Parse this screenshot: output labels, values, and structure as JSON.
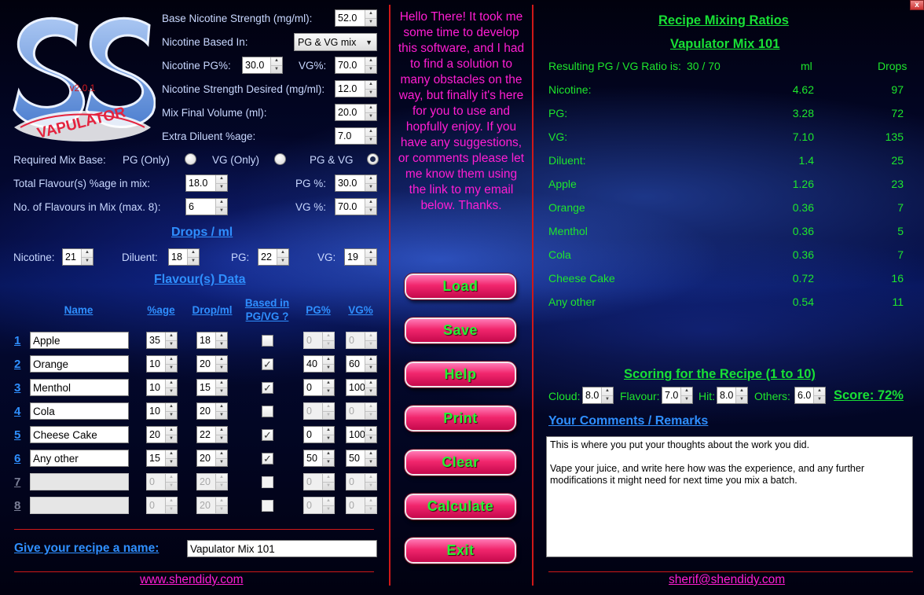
{
  "app": {
    "close_label": "x",
    "logo": {
      "version": "v2.0.1",
      "name": "VAPULATOR",
      "letters": "SS"
    }
  },
  "settings": {
    "base_nicotine_label": "Base Nicotine Strength (mg/ml):",
    "base_nicotine_value": "52.0",
    "nicotine_based_in_label": "Nicotine Based In:",
    "nicotine_based_in_value": "PG & VG mix",
    "nicotine_pg_label": "Nicotine PG%:",
    "nicotine_pg_value": "30.0",
    "nicotine_vg_label": "VG%:",
    "nicotine_vg_value": "70.0",
    "nicotine_desired_label": "Nicotine Strength Desired (mg/ml):",
    "nicotine_desired_value": "12.0",
    "final_volume_label": "Mix Final Volume (ml):",
    "final_volume_value": "20.0",
    "extra_diluent_label": "Extra Diluent %age:",
    "extra_diluent_value": "7.0",
    "mix_base_label": "Required Mix Base:",
    "mix_base_pg_label": "PG (Only)",
    "mix_base_vg_label": "VG (Only)",
    "mix_base_pgvg_label": "PG & VG",
    "total_flavour_label": "Total Flavour(s) %age in mix:",
    "total_flavour_value": "18.0",
    "pg_pct_label": "PG %:",
    "pg_pct_value": "30.0",
    "no_flavours_label": "No. of Flavours in Mix (max. 8):",
    "no_flavours_value": "6",
    "vg_pct_label": "VG %:",
    "vg_pct_value": "70.0"
  },
  "drops": {
    "title": "Drops / ml",
    "nicotine_label": "Nicotine:",
    "nicotine_value": "21",
    "diluent_label": "Diluent:",
    "diluent_value": "18",
    "pg_label": "PG:",
    "pg_value": "22",
    "vg_label": "VG:",
    "vg_value": "19"
  },
  "flavours": {
    "title": "Flavour(s) Data",
    "columns": {
      "name": "Name",
      "pct": "%age",
      "drop": "Drop/ml",
      "based": "Based in PG/VG ?",
      "pg": "PG%",
      "vg": "VG%"
    },
    "rows": [
      {
        "num": "1",
        "name": "Apple",
        "pct": "35",
        "drop": "18",
        "based": false,
        "pg": "0",
        "vg": "0"
      },
      {
        "num": "2",
        "name": "Orange",
        "pct": "10",
        "drop": "20",
        "based": true,
        "pg": "40",
        "vg": "60"
      },
      {
        "num": "3",
        "name": "Menthol",
        "pct": "10",
        "drop": "15",
        "based": true,
        "pg": "0",
        "vg": "100"
      },
      {
        "num": "4",
        "name": "Cola",
        "pct": "10",
        "drop": "20",
        "based": false,
        "pg": "0",
        "vg": "0"
      },
      {
        "num": "5",
        "name": "Cheese Cake",
        "pct": "20",
        "drop": "22",
        "based": true,
        "pg": "0",
        "vg": "100"
      },
      {
        "num": "6",
        "name": "Any other",
        "pct": "15",
        "drop": "20",
        "based": true,
        "pg": "50",
        "vg": "50"
      },
      {
        "num": "7",
        "name": "",
        "pct": "0",
        "drop": "20",
        "based": false,
        "pg": "0",
        "vg": "0"
      },
      {
        "num": "8",
        "name": "",
        "pct": "0",
        "drop": "20",
        "based": false,
        "pg": "0",
        "vg": "0"
      }
    ]
  },
  "recipe_name": {
    "label": "Give your recipe a name:",
    "value": "Vapulator Mix 101"
  },
  "links": {
    "website": "www.shendidy.com",
    "email": "sherif@shendidy.com"
  },
  "blurb": "Hello There! It took me some time to develop this software, and I had to find a solution to many obstacles on the way, but finally it's here for you to use and hopfully enjoy. If you have any suggestions, or comments please let me know them using the link to my email below. Thanks.",
  "buttons": {
    "load": "Load",
    "save": "Save",
    "help": "Help",
    "print": "Print",
    "clear": "Clear",
    "calculate": "Calculate",
    "exit": "Exit"
  },
  "results": {
    "title": "Recipe Mixing Ratios",
    "recipe_title": "Vapulator Mix 101",
    "ratio_label": "Resulting PG / VG Ratio is:",
    "ratio_value": "30 / 70",
    "ml_header": "ml",
    "drops_header": "Drops",
    "rows": [
      {
        "name": "Nicotine:",
        "ml": "4.62",
        "drops": "97"
      },
      {
        "name": "PG:",
        "ml": "3.28",
        "drops": "72"
      },
      {
        "name": "VG:",
        "ml": "7.10",
        "drops": "135"
      },
      {
        "name": "Diluent:",
        "ml": "1.4",
        "drops": "25"
      },
      {
        "name": "Apple",
        "ml": "1.26",
        "drops": "23"
      },
      {
        "name": "Orange",
        "ml": "0.36",
        "drops": "7"
      },
      {
        "name": "Menthol",
        "ml": "0.36",
        "drops": "5"
      },
      {
        "name": "Cola",
        "ml": "0.36",
        "drops": "7"
      },
      {
        "name": "Cheese Cake",
        "ml": "0.72",
        "drops": "16"
      },
      {
        "name": "Any other",
        "ml": "0.54",
        "drops": "11"
      }
    ]
  },
  "scoring": {
    "title": "Scoring for the Recipe (1 to 10)",
    "cloud_label": "Cloud:",
    "cloud_value": "8.0",
    "flavour_label": "Flavour:",
    "flavour_value": "7.0",
    "hit_label": "Hit:",
    "hit_value": "8.0",
    "others_label": "Others:",
    "others_value": "6.0",
    "score_text": "Score: 72%"
  },
  "comments": {
    "title": "Your Comments / Remarks",
    "text": "This is where you put your thoughts about the work you did.\n\nVape your juice, and write here how was the experience, and any further modifications it might need for next time you mix a batch."
  },
  "colors": {
    "accent_blue": "#2f8fff",
    "accent_green": "#1ee72c",
    "accent_pink": "#ff1ed2",
    "divider_red": "#d01818"
  }
}
